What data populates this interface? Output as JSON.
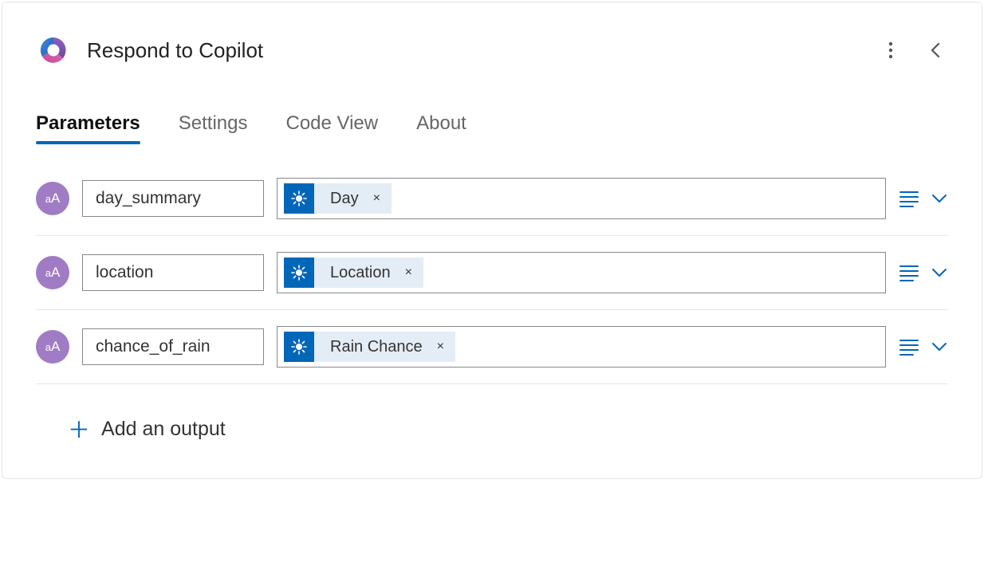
{
  "header": {
    "title": "Respond to Copilot"
  },
  "tabs": [
    {
      "label": "Parameters",
      "active": true
    },
    {
      "label": "Settings",
      "active": false
    },
    {
      "label": "Code View",
      "active": false
    },
    {
      "label": "About",
      "active": false
    }
  ],
  "parameters": [
    {
      "name": "day_summary",
      "token": "Day"
    },
    {
      "name": "location",
      "token": "Location"
    },
    {
      "name": "chance_of_rain",
      "token": "Rain Chance"
    }
  ],
  "add_output_label": "Add an output",
  "token_remove_glyph": "×"
}
